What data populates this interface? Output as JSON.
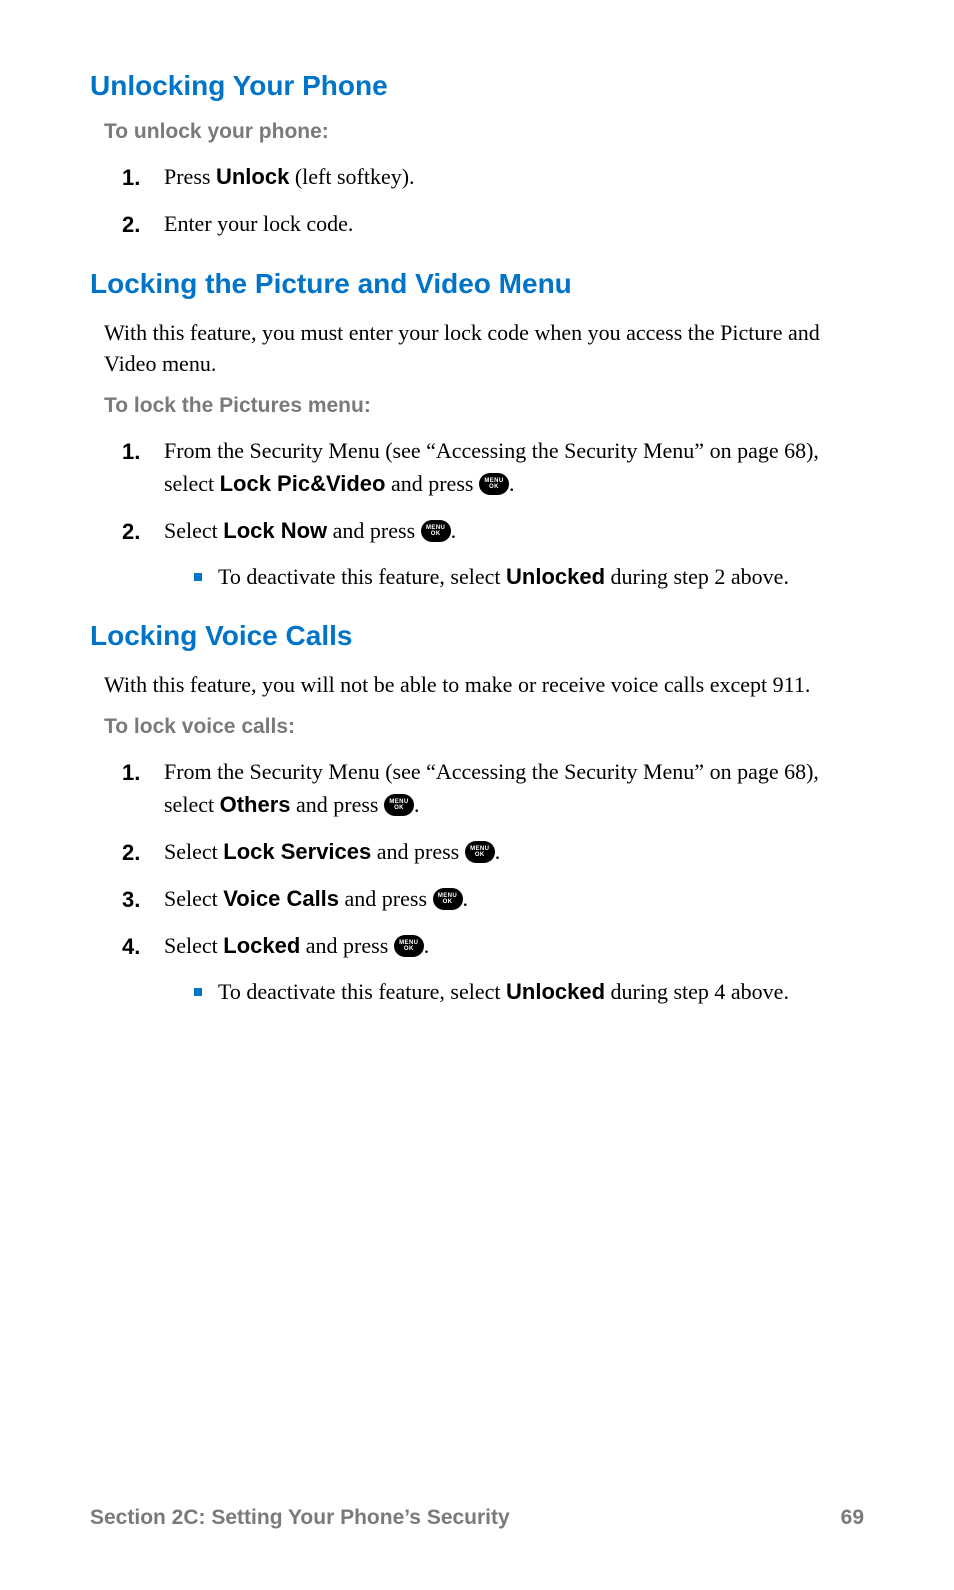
{
  "sections": [
    {
      "heading": "Unlocking Your Phone",
      "subheading": "To unlock your phone:",
      "steps": [
        {
          "parts": [
            {
              "text": "Press "
            },
            {
              "text": "Unlock",
              "bold": true
            },
            {
              "text": " (left softkey)."
            }
          ]
        },
        {
          "parts": [
            {
              "text": "Enter your lock code."
            }
          ]
        }
      ]
    },
    {
      "heading": "Locking the Picture and Video Menu",
      "intro": "With this feature, you must enter your lock code when you access the Picture and Video menu.",
      "subheading": "To lock the Pictures menu:",
      "steps": [
        {
          "parts": [
            {
              "text": "From the Security Menu (see “Accessing the Security Menu” on page 68), select "
            },
            {
              "text": "Lock Pic&Video",
              "bold": true
            },
            {
              "text": " and press "
            },
            {
              "icon": "menu-ok"
            },
            {
              "text": "."
            }
          ]
        },
        {
          "parts": [
            {
              "text": "Select "
            },
            {
              "text": "Lock Now",
              "bold": true
            },
            {
              "text": " and press "
            },
            {
              "icon": "menu-ok"
            },
            {
              "text": "."
            }
          ],
          "bullet": [
            {
              "text": "To deactivate this feature, select "
            },
            {
              "text": "Unlocked",
              "bold": true
            },
            {
              "text": " during step 2 above."
            }
          ]
        }
      ]
    },
    {
      "heading": "Locking Voice Calls",
      "intro": "With this feature, you will not be able to make or receive voice calls except 911.",
      "subheading": "To lock voice calls:",
      "steps": [
        {
          "parts": [
            {
              "text": "From the Security Menu (see “Accessing the Security Menu” on page 68), select "
            },
            {
              "text": "Others",
              "bold": true
            },
            {
              "text": " and press "
            },
            {
              "icon": "menu-ok"
            },
            {
              "text": "."
            }
          ]
        },
        {
          "parts": [
            {
              "text": "Select "
            },
            {
              "text": "Lock Services",
              "bold": true
            },
            {
              "text": " and press "
            },
            {
              "icon": "menu-ok"
            },
            {
              "text": "."
            }
          ]
        },
        {
          "parts": [
            {
              "text": "Select "
            },
            {
              "text": "Voice Calls",
              "bold": true
            },
            {
              "text": " and press "
            },
            {
              "icon": "menu-ok"
            },
            {
              "text": "."
            }
          ]
        },
        {
          "parts": [
            {
              "text": "Select "
            },
            {
              "text": "Locked",
              "bold": true
            },
            {
              "text": " and press "
            },
            {
              "icon": "menu-ok"
            },
            {
              "text": "."
            }
          ],
          "bullet": [
            {
              "text": "To deactivate this feature, select "
            },
            {
              "text": "Unlocked",
              "bold": true
            },
            {
              "text": " during step 4 above."
            }
          ]
        }
      ]
    }
  ],
  "footer": {
    "left": "Section 2C: Setting Your Phone’s Security",
    "right": "69"
  },
  "icon_label": {
    "top": "MENU",
    "bottom": "OK"
  }
}
